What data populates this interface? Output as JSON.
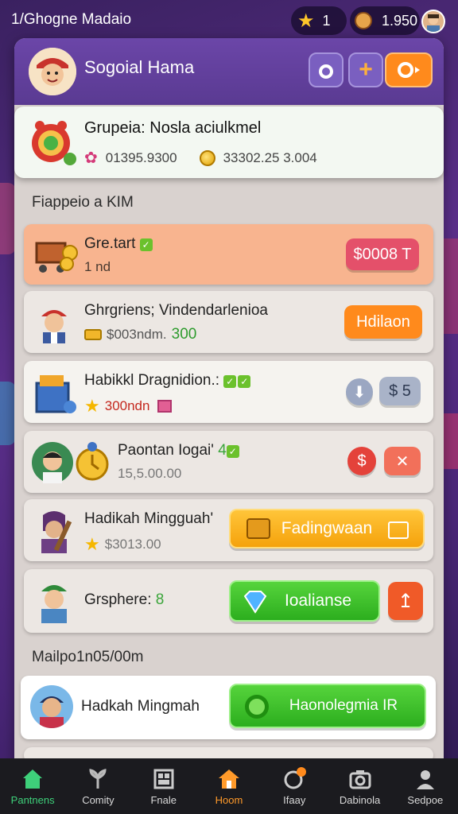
{
  "status_bar": {
    "title": "1/Ghogne Madaio",
    "stars": "1",
    "gold": "1.950"
  },
  "header": {
    "name": "Sogoial Hama",
    "btn_plus": "+"
  },
  "featured": {
    "name": "Grupeia: Nosla aciulkmel",
    "value1": "01395.9300",
    "value2": "33302.25 3.004"
  },
  "section1": "Fiappeio a KIM",
  "rows": [
    {
      "name": "Gre.tart",
      "sub": "1 nd",
      "button": "$0008 T"
    },
    {
      "name": "Ghrgriens; Vindendarlenioa",
      "sub_a": "$003ndm.",
      "sub_b": "300",
      "button": "Hdilaon"
    },
    {
      "name": "Habikkl Dragnidion.:",
      "sub": "300ndn",
      "button": "$ 5"
    },
    {
      "name": "Paontan Iogai'",
      "tag": "4",
      "sub": "15,5.00.00",
      "button_x": "✕"
    },
    {
      "name": "Hadikah Mingguah'",
      "sub": "$3013.00",
      "button": "Fadingwaan"
    },
    {
      "name": "Grsphere:",
      "tag": "8",
      "button": "Ioalianse"
    }
  ],
  "section2": "Mailpo1n05/00m",
  "bottom_row": {
    "name": "Hadkah Mingmah",
    "button": "Haonolegmia IR"
  },
  "nav": [
    {
      "label": "Pantnens",
      "icon": "home-icon"
    },
    {
      "label": "Comity",
      "icon": "plant-icon"
    },
    {
      "label": "Fnale",
      "icon": "grid-icon"
    },
    {
      "label": "Hoom",
      "icon": "house-icon"
    },
    {
      "label": "Ifaay",
      "icon": "chat-icon"
    },
    {
      "label": "Dabinola",
      "icon": "camera-icon"
    },
    {
      "label": "Sedpoe",
      "icon": "profile-icon"
    }
  ]
}
